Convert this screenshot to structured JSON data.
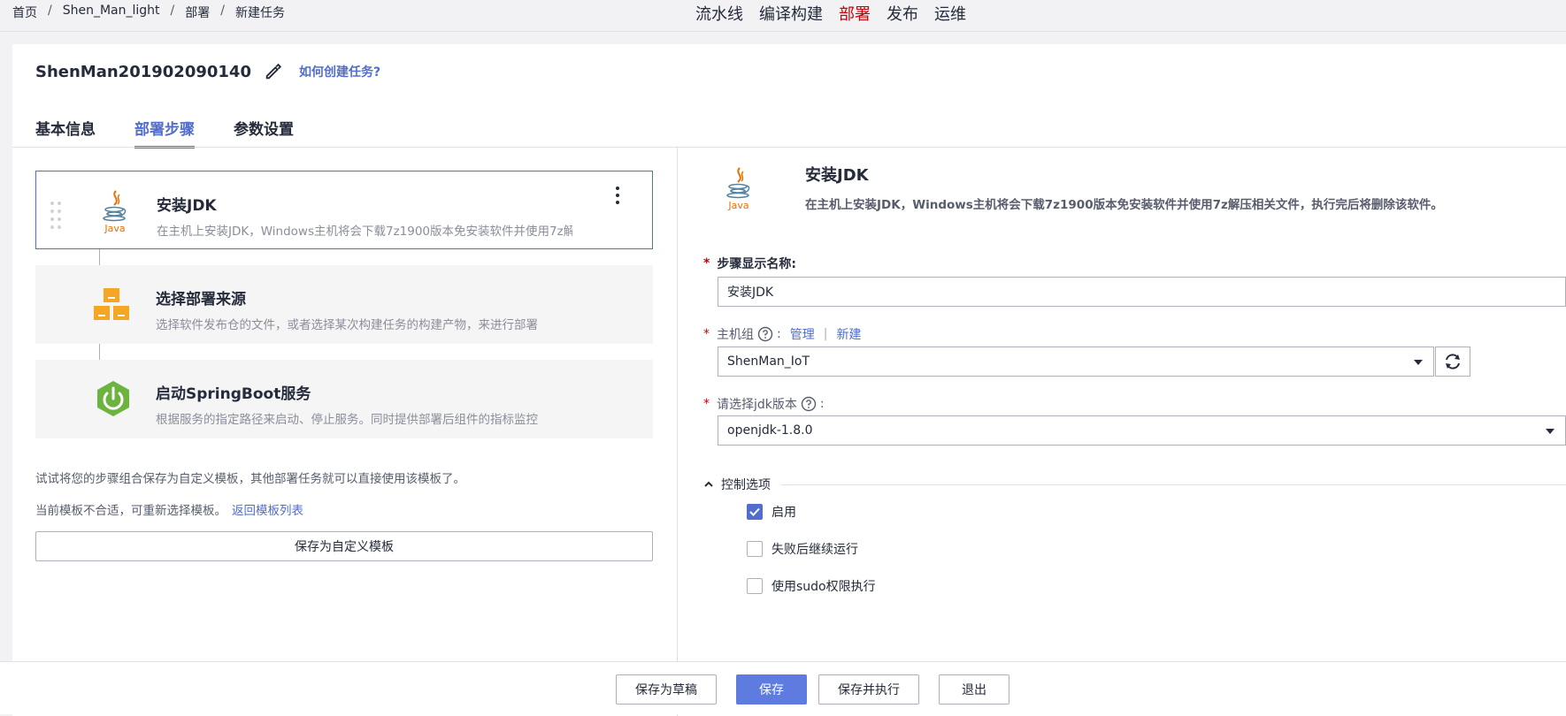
{
  "breadcrumb": [
    "首页",
    "Shen_Man_light",
    "部署",
    "新建任务"
  ],
  "breadcrumb_sep": "/",
  "topnav": [
    {
      "label": "流水线",
      "active": false
    },
    {
      "label": "编译构建",
      "active": false
    },
    {
      "label": "部署",
      "active": true
    },
    {
      "label": "发布",
      "active": false
    },
    {
      "label": "运维",
      "active": false
    }
  ],
  "task": {
    "name": "ShenMan201902090140",
    "help_link": "如何创建任务?"
  },
  "tabs": [
    {
      "label": "基本信息",
      "active": false
    },
    {
      "label": "部署步骤",
      "active": true
    },
    {
      "label": "参数设置",
      "active": false
    }
  ],
  "steps": [
    {
      "title": "安装JDK",
      "desc": "在主机上安装JDK，Windows主机将会下载7z1900版本免安装软件并使用7z解压相关文件，执行完后将删除该软件。",
      "icon": "java-icon",
      "selected": true
    },
    {
      "title": "选择部署来源",
      "desc": "选择软件发布仓的文件，或者选择某次构建任务的构建产物，来进行部署",
      "icon": "package-source-icon",
      "selected": false
    },
    {
      "title": "启动SpringBoot服务",
      "desc": "根据服务的指定路径来启动、停止服务。同时提供部署后组件的指标监控",
      "icon": "springboot-power-icon",
      "selected": false
    }
  ],
  "template_tip": "试试将您的步骤组合保存为自定义模板，其他部署任务就可以直接使用该模板了。",
  "template_tip2": "当前模板不合适，可重新选择模板。",
  "template_back_link": "返回模板列表",
  "save_template_label": "保存为自定义模板",
  "detail": {
    "title": "安装JDK",
    "desc": "在主机上安装JDK，Windows主机将会下载7z1900版本免安装软件并使用7z解压相关文件，执行完后将删除该软件。",
    "java_text": "Java",
    "step_name_label": "步骤显示名称:",
    "step_name_value": "安装JDK",
    "host_group_label": "主机组",
    "host_group_manage": "管理",
    "host_group_sep": "|",
    "host_group_new": "新建",
    "host_group_value": "ShenMan_IoT",
    "jdk_label": "请选择jdk版本",
    "jdk_value": "openjdk-1.8.0",
    "colon": ":",
    "control_title": "控制选项",
    "checks": [
      {
        "label": "启用",
        "checked": true
      },
      {
        "label": "失败后继续运行",
        "checked": false
      },
      {
        "label": "使用sudo权限执行",
        "checked": false
      }
    ]
  },
  "footer": {
    "draft": "保存为草稿",
    "save": "保存",
    "save_run": "保存并执行",
    "exit": "退出"
  },
  "colors": {
    "accent": "#526ecc",
    "primary_button": "#5e7ce0",
    "active_nav": "#c7000b",
    "java_red": "#e76f00",
    "java_blue": "#5382a1",
    "package_orange": "#f5a623",
    "spring_green": "#6db33f"
  }
}
